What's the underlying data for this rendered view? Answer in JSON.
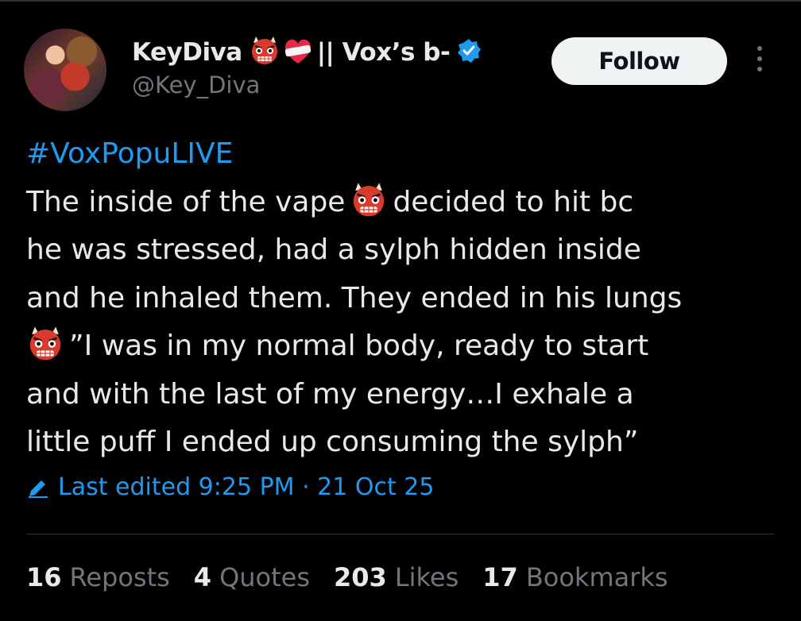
{
  "author": {
    "display_name_prefix": "KeyDiva",
    "display_name_suffix": "|| Vox’s b-",
    "handle": "@Key_Diva",
    "verified": true
  },
  "follow_label": "Follow",
  "post": {
    "hashtag": "#VoxPopuLIVE",
    "line1_before": "The inside of the vape",
    "line1_after": "decided to hit bc",
    "line2": "he was stressed, had a sylph hidden inside",
    "line3": "and he inhaled them. They ended in his lungs",
    "line4_after": "”I was in my normal body, ready to start",
    "line5": "and with the last of my energy…I exhale a",
    "line6": "little puff I ended up consuming the sylph”"
  },
  "edited": "Last edited 9:25 PM · 21 Oct 25",
  "stats": {
    "reposts_count": "16",
    "reposts_label": "Reposts",
    "quotes_count": "4",
    "quotes_label": "Quotes",
    "likes_count": "203",
    "likes_label": "Likes",
    "bookmarks_count": "17",
    "bookmarks_label": "Bookmarks"
  },
  "colors": {
    "background": "#000000",
    "text": "#e7e9ea",
    "secondary": "#71767b",
    "accent": "#1d9bf0"
  },
  "icons": [
    "ogre-emoji",
    "mending-heart-emoji",
    "verified-badge-icon",
    "more-options-icon",
    "pencil-icon"
  ]
}
